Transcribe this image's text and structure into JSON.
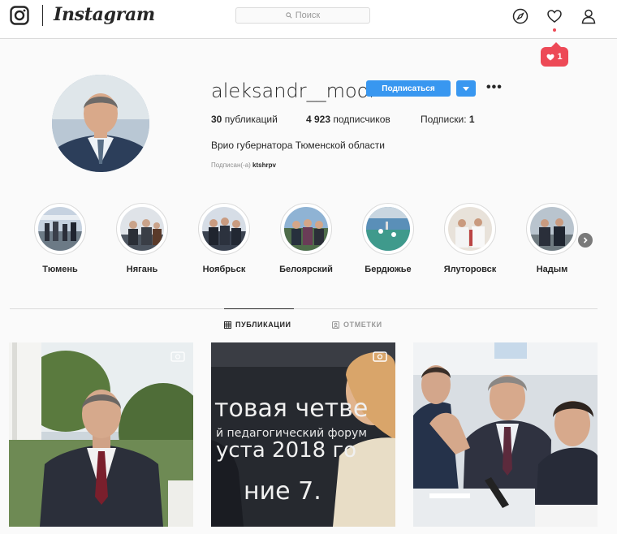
{
  "brand": {
    "wordmark": "Instagram",
    "logo_icon": "instagram-camera-icon"
  },
  "search": {
    "placeholder": "Поиск",
    "icon": "search-icon"
  },
  "nav": {
    "explore_icon": "compass-icon",
    "activity_icon": "heart-icon",
    "profile_icon": "person-icon"
  },
  "notification": {
    "count": "1",
    "icon": "heart-filled-icon"
  },
  "profile": {
    "username": "aleksandr__moor",
    "follow_label": "Подписаться",
    "options_icon": "ellipsis-icon",
    "stats": {
      "posts_num": "30",
      "posts_label": "публикаций",
      "followers_num": "4 923",
      "followers_label": "подписчиков",
      "following_label": "Подписки:",
      "following_num": "1"
    },
    "bio": "Врио губернатора Тюменской области",
    "followed_by_label": "Подписан(-а)",
    "followed_by_user": "ktshrpv"
  },
  "highlights": [
    {
      "label": "Тюмень"
    },
    {
      "label": "Нягань"
    },
    {
      "label": "Ноябрьск"
    },
    {
      "label": "Белоярский"
    },
    {
      "label": "Бердюжье"
    },
    {
      "label": "Ялуторовск"
    },
    {
      "label": "Надым"
    }
  ],
  "tabs": [
    {
      "label": "ПУБЛИКАЦИИ",
      "icon": "grid-icon",
      "active": true
    },
    {
      "label": "ОТМЕТКИ",
      "icon": "tagged-icon",
      "active": false
    }
  ],
  "posts": [
    {
      "badge": "igtv-icon"
    },
    {
      "badge": "igtv-icon",
      "sign_line1": "товая четве",
      "sign_line2": "й педагогический форум",
      "sign_line3": "уста 2018 го",
      "sign_line4": "ние 7."
    },
    {
      "badge": ""
    }
  ],
  "colors": {
    "accent": "#3897f0",
    "notification": "#ed4956",
    "border": "#dbdbdb",
    "background": "#fafafa"
  }
}
